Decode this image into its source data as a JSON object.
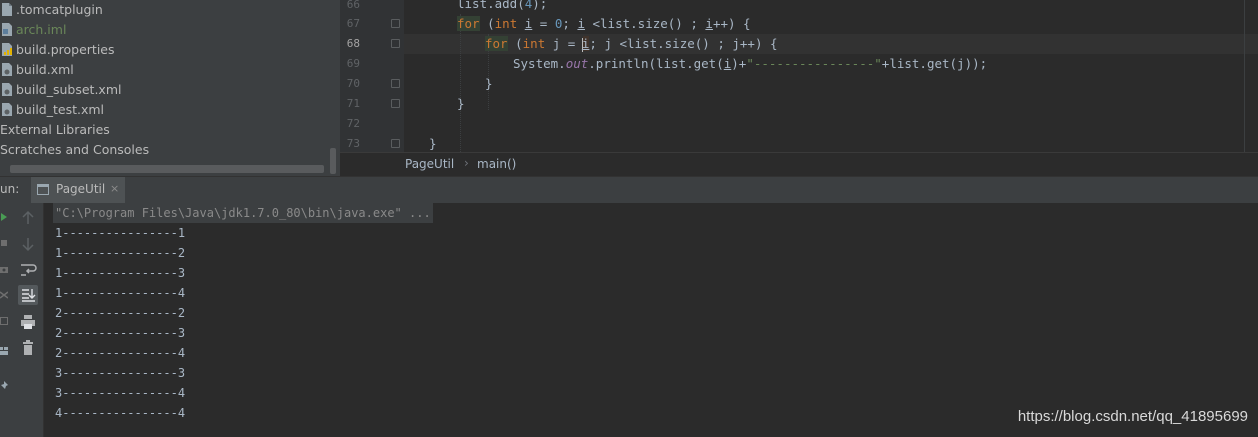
{
  "project_tree": {
    "items": [
      {
        "label": ".tomcatplugin"
      },
      {
        "label": "arch.iml"
      },
      {
        "label": "build.properties"
      },
      {
        "label": "build.xml"
      },
      {
        "label": "build_subset.xml"
      },
      {
        "label": "build_test.xml"
      },
      {
        "label": "External Libraries"
      },
      {
        "label": "Scratches and Consoles"
      }
    ]
  },
  "editor": {
    "line_numbers": [
      "66",
      "67",
      "68",
      "69",
      "70",
      "71",
      "72",
      "73"
    ],
    "current_line": "68"
  },
  "breadcrumb": {
    "class_name": "PageUtil",
    "separator": "›",
    "method_name": "main()"
  },
  "run_panel": {
    "label": "un:",
    "tab_label": "PageUtil",
    "tab_close": "×",
    "command": "\"C:\\Program Files\\Java\\jdk1.7.0_80\\bin\\java.exe\" ...",
    "output": [
      "1----------------1",
      "1----------------2",
      "1----------------3",
      "1----------------4",
      "2----------------2",
      "2----------------3",
      "2----------------4",
      "3----------------3",
      "3----------------4",
      "4----------------4"
    ]
  },
  "watermark": "https://blog.csdn.net/qq_41895699",
  "colors": {
    "keyword": "#cc7832",
    "number": "#6897bb",
    "string": "#6a8759",
    "field": "#9876aa",
    "text": "#a9b7c6",
    "panel": "#3c3f41",
    "editor_bg": "#2b2b2b"
  },
  "icons": {
    "tree_items": [
      "file-icon",
      "iml-module-icon",
      "properties-file-icon",
      "ant-xml-icon",
      "ant-xml-icon",
      "ant-xml-icon"
    ],
    "toolbar": [
      "rerun-icon",
      "stop-icon",
      "camera-icon",
      "settings-icon",
      "restore-layout-icon",
      "layout-icon",
      "pin-icon",
      "up-arrow-icon",
      "down-arrow-icon",
      "soft-wrap-icon",
      "scroll-to-end-icon",
      "print-icon",
      "trash-icon"
    ]
  }
}
